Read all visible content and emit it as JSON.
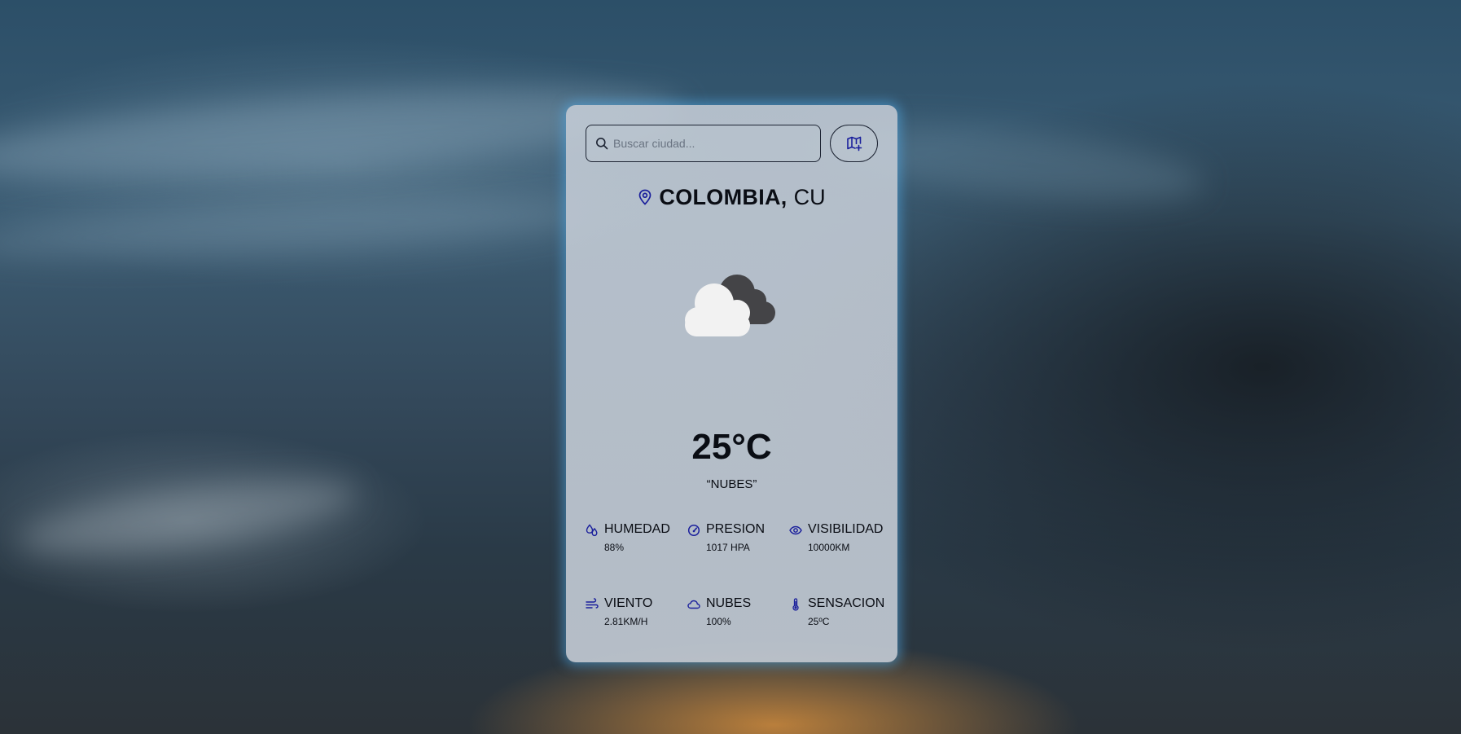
{
  "search": {
    "placeholder": "Buscar ciudad..."
  },
  "location": {
    "city": "COLOMBIA,",
    "country": "CU"
  },
  "weather": {
    "temperature": "25°C",
    "description": "“NUBES”",
    "icon": "partly-cloudy-icon"
  },
  "stats": [
    {
      "label": "HUMEDAD",
      "value": "88%",
      "icon": "humidity-icon"
    },
    {
      "label": "PRESION",
      "value": "1017 HPA",
      "icon": "gauge-icon"
    },
    {
      "label": "VISIBILIDAD",
      "value": "10000KM",
      "icon": "eye-icon"
    },
    {
      "label": "VIENTO",
      "value": "2.81KM/H",
      "icon": "wind-icon"
    },
    {
      "label": "NUBES",
      "value": "100%",
      "icon": "cloud-icon"
    },
    {
      "label": "SENSACION",
      "value": "25ºC",
      "icon": "thermometer-icon"
    }
  ],
  "colors": {
    "accent": "#1a1f9c",
    "card_glow": "#50aae6",
    "text": "#0a0d14"
  }
}
